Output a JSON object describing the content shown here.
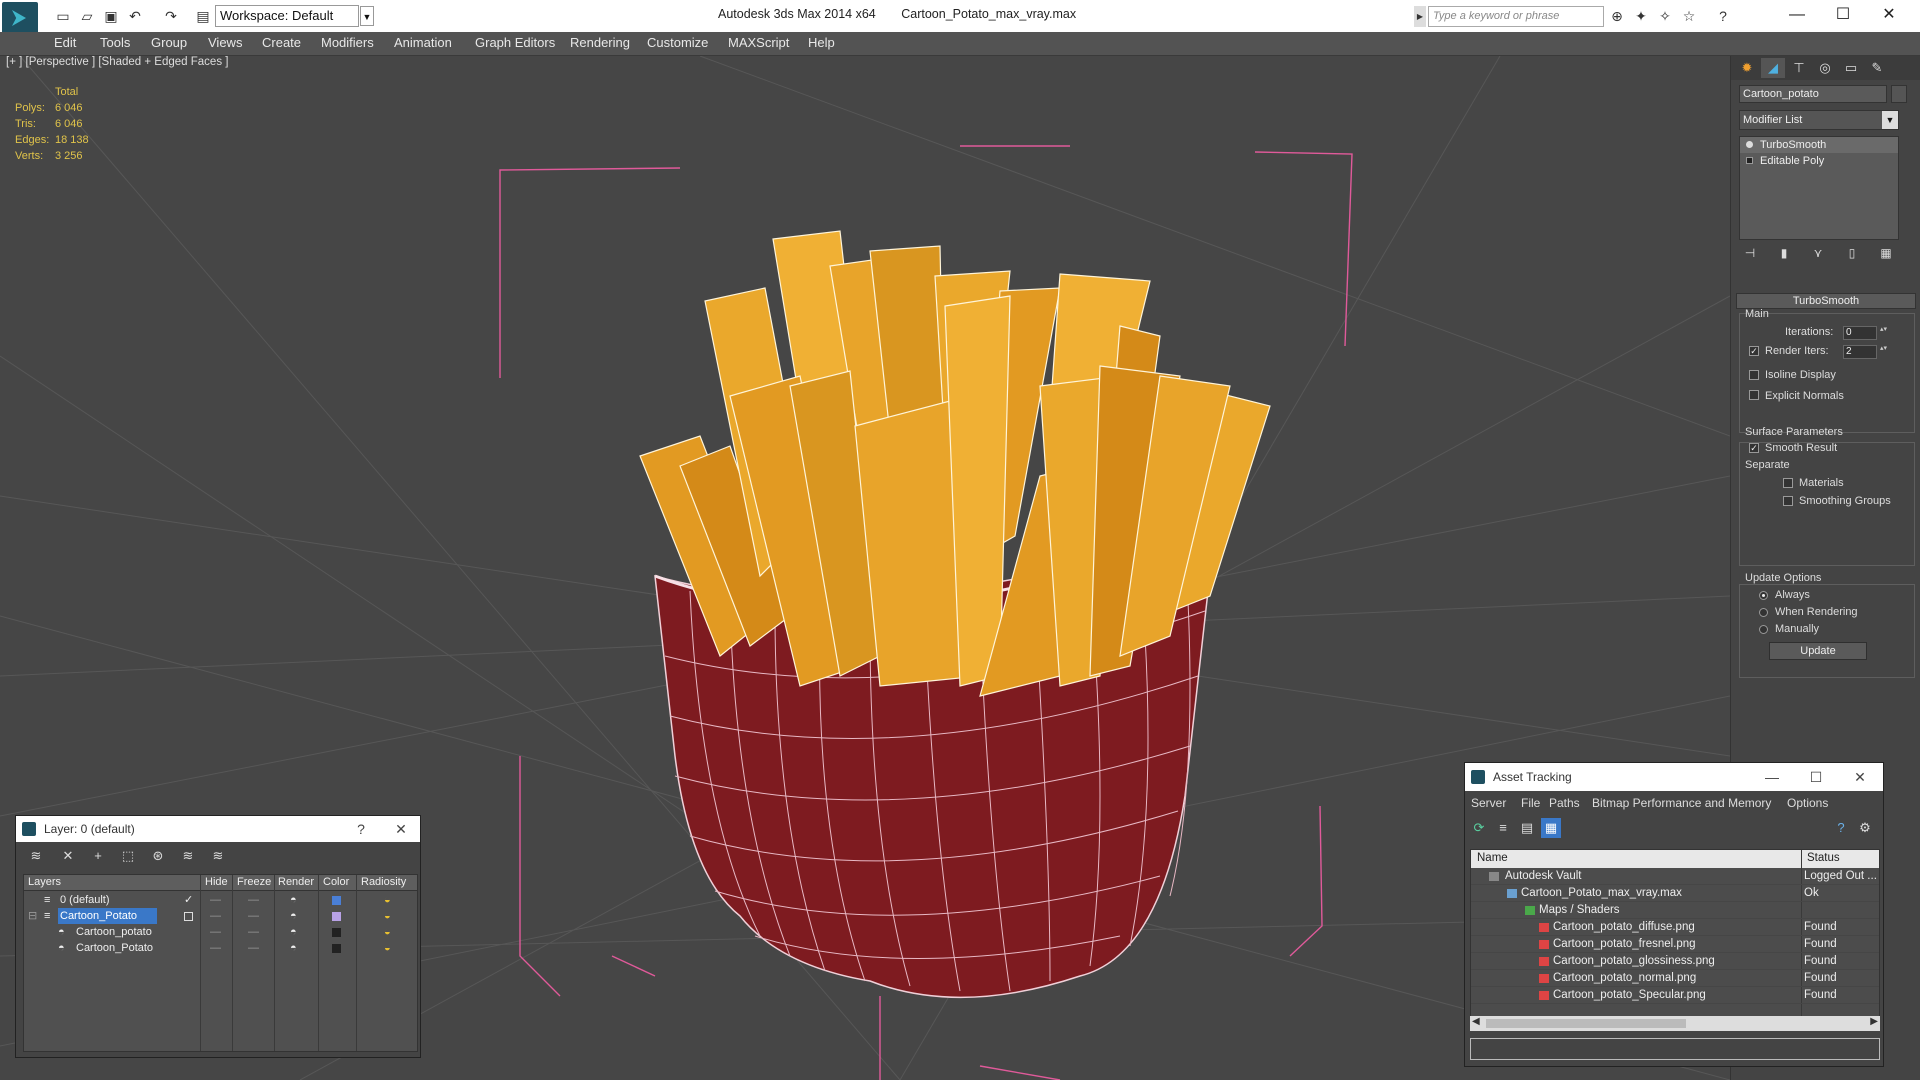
{
  "titlebar": {
    "workspace": "Workspace: Default",
    "app_name": "Autodesk 3ds Max  2014 x64",
    "file_name": "Cartoon_Potato_max_vray.max",
    "search_placeholder": "Type a keyword or phrase"
  },
  "menu": [
    "Edit",
    "Tools",
    "Group",
    "Views",
    "Create",
    "Modifiers",
    "Animation",
    "Graph Editors",
    "Rendering",
    "Customize",
    "MAXScript",
    "Help"
  ],
  "viewport": {
    "label": "[+ ] [Perspective ] [Shaded + Edged Faces ]",
    "stats_header": "Total",
    "stats": [
      {
        "k": "Polys:",
        "v": "6 046"
      },
      {
        "k": "Tris:",
        "v": "6 046"
      },
      {
        "k": "Edges:",
        "v": "18 138"
      },
      {
        "k": "Verts:",
        "v": "3 256"
      }
    ]
  },
  "command_panel": {
    "object_name": "Cartoon_potato",
    "modifier_list": "Modifier List",
    "stack": [
      "TurboSmooth",
      "Editable Poly"
    ],
    "rollout_title": "TurboSmooth",
    "main_label": "Main",
    "iterations_label": "Iterations:",
    "iterations_value": "0",
    "render_iters_label": "Render Iters:",
    "render_iters_value": "2",
    "isoline_label": "Isoline Display",
    "explicit_normals_label": "Explicit Normals",
    "surface_params_label": "Surface Parameters",
    "smooth_result_label": "Smooth Result",
    "separate_label": "Separate",
    "materials_label": "Materials",
    "smoothing_groups_label": "Smoothing Groups",
    "update_options_label": "Update Options",
    "always_label": "Always",
    "when_rendering_label": "When Rendering",
    "manually_label": "Manually",
    "update_button": "Update"
  },
  "layer_panel": {
    "title": "Layer: 0 (default)",
    "help": "?",
    "columns": [
      "Layers",
      "Hide",
      "Freeze",
      "Render",
      "Color",
      "Radiosity"
    ],
    "rows": [
      {
        "name": "0 (default)",
        "color": "#4a7fd6"
      },
      {
        "name": "Cartoon_Potato",
        "color": "#b9a2e6"
      },
      {
        "name": "Cartoon_potato",
        "color": "#222222"
      },
      {
        "name": "Cartoon_Potato",
        "color": "#222222"
      }
    ]
  },
  "asset_panel": {
    "title": "Asset Tracking",
    "menu": [
      "Server",
      "File",
      "Paths",
      "Bitmap Performance and Memory",
      "Options"
    ],
    "columns": [
      "Name",
      "Status"
    ],
    "rows": [
      {
        "name": "Autodesk Vault",
        "status": "Logged Out ..."
      },
      {
        "name": "Cartoon_Potato_max_vray.max",
        "status": "Ok"
      },
      {
        "name": "Maps / Shaders",
        "status": ""
      },
      {
        "name": "Cartoon_potato_diffuse.png",
        "status": "Found"
      },
      {
        "name": "Cartoon_potato_fresnel.png",
        "status": "Found"
      },
      {
        "name": "Cartoon_potato_glossiness.png",
        "status": "Found"
      },
      {
        "name": "Cartoon_potato_normal.png",
        "status": "Found"
      },
      {
        "name": "Cartoon_potato_Specular.png",
        "status": "Found"
      }
    ]
  },
  "colors": {
    "fries": "#e8a42a",
    "cup": "#8a1e22",
    "grid": "#585858",
    "stats": "#e0c34a"
  }
}
